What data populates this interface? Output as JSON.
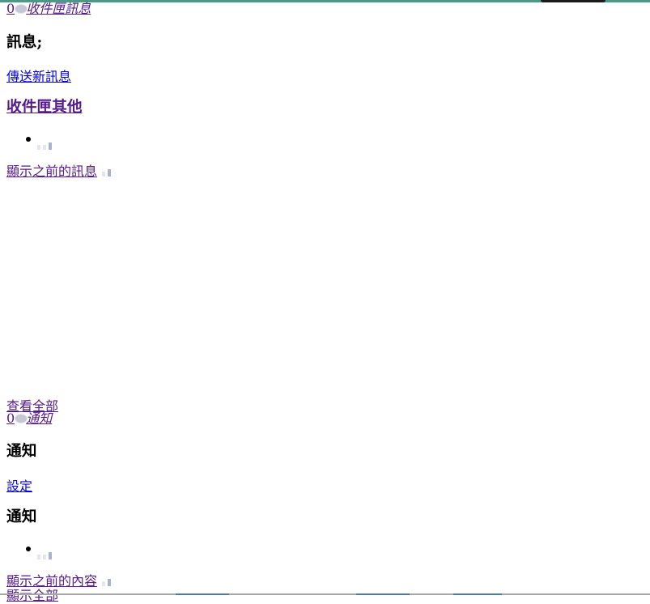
{
  "messages_jewel": {
    "count": "0",
    "label": "收件匣訊息"
  },
  "messages_flyout": {
    "title": "訊息;",
    "send_new": "傳送新訊息",
    "inbox_other": "收件匣其他",
    "show_older": "顯示之前的訊息",
    "see_all": "查看全部"
  },
  "notifications_jewel": {
    "count": "0",
    "label": "通知"
  },
  "notifications_flyout": {
    "title": "通知",
    "settings": "設定",
    "list_title": "通知",
    "show_older": "顯示之前的內容",
    "show_all": "顯示全部"
  },
  "colors": {
    "link": "#0000ee",
    "visited_link": "#551a8b",
    "top_accent": "#4a9a86"
  }
}
